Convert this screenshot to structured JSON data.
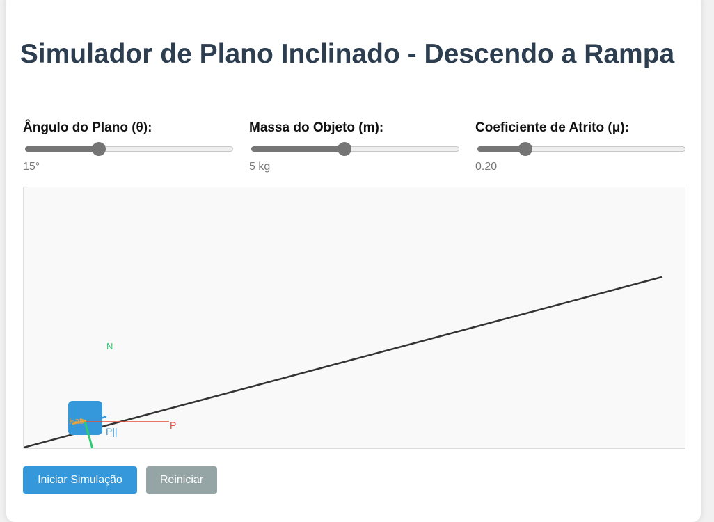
{
  "title": "Simulador de Plano Inclinado - Descendo a Rampa",
  "controls": [
    {
      "label": "Ângulo do Plano (θ):",
      "value": "15°",
      "fraction": 0.35
    },
    {
      "label": "Massa do Objeto (m):",
      "value": "5 kg",
      "fraction": 0.45
    },
    {
      "label": "Coeficiente de Atrito (μ):",
      "value": "0.20",
      "fraction": 0.22
    }
  ],
  "simulation": {
    "labels": {
      "normal": "N",
      "friction": "Fat",
      "parallel_weight": "P||",
      "weight": "P"
    },
    "colors": {
      "plane": "#333333",
      "block": "#3498db",
      "normal": "#2ecc71",
      "friction": "#e6a23c",
      "parallel_weight": "#3498db",
      "weight": "#e74c3c"
    }
  },
  "buttons": {
    "start": "Iniciar Simulação",
    "reset": "Reiniciar"
  }
}
